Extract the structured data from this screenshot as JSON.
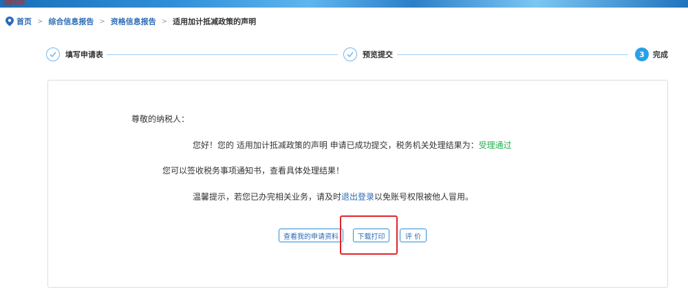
{
  "banner": {
    "mark": "国家税务"
  },
  "breadcrumb": {
    "home": "首页",
    "level1": "综合信息报告",
    "level2": "资格信息报告",
    "current": "适用加计抵减政策的声明",
    "separator": ">"
  },
  "steps": [
    {
      "label": "填写申请表",
      "state": "done"
    },
    {
      "label": "预览提交",
      "state": "done"
    },
    {
      "number": "3",
      "label": "完成",
      "state": "active"
    }
  ],
  "message": {
    "greeting": "尊敬的纳税人：",
    "line1_prefix": "您好！您的 适用加计抵减政策的声明 申请已成功提交，税务机关处理结果为：",
    "line1_result": "受理通过",
    "line2": "您可以签收税务事项通知书，查看具体处理结果！",
    "line3_prefix": "温馨提示，若您已办完相关业务，请及时",
    "line3_link": "退出登录",
    "line3_suffix": "以免账号权限被他人冒用。"
  },
  "buttons": {
    "view": "查看我的申请资料",
    "download": "下载打印",
    "rate": "评 价"
  },
  "colors": {
    "accent": "#29a1e6",
    "link": "#2b6bb5",
    "success": "#22b14c",
    "highlight": "#e0242a"
  }
}
